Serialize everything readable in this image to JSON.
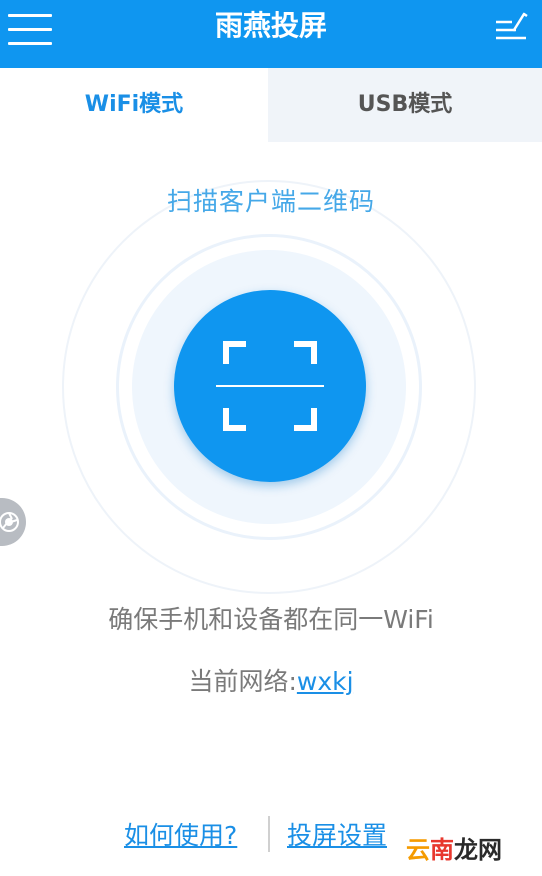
{
  "header": {
    "title": "雨燕投屏",
    "menu_icon": "hamburger-menu-icon",
    "edit_icon": "edit-list-icon",
    "background": "#0f96f0"
  },
  "tabs": [
    {
      "label": "WiFi模式",
      "active": true
    },
    {
      "label": "USB模式",
      "active": false
    }
  ],
  "scan": {
    "title": "扫描客户端二维码",
    "icon": "qr-scan-icon",
    "accent": "#0f96f0"
  },
  "side_float_icon": "camera-shutter-icon",
  "hint": "确保手机和设备都在同一WiFi",
  "network": {
    "label": "当前网络:",
    "name": "wxkj"
  },
  "footer": {
    "how_to_use": "如何使用?",
    "cast_settings": "投屏设置"
  },
  "watermark": {
    "part1": "云",
    "part2": "南",
    "part3": "龙网"
  }
}
